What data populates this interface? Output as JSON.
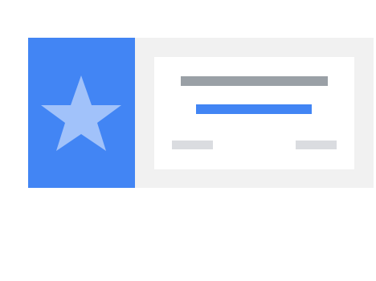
{
  "colors": {
    "accent": "#4285f4",
    "star": "#a1c2fa",
    "backdrop": "#f1f1f1",
    "card": "#ffffff",
    "title_bar": "#9aa0a6",
    "placeholder_bar": "#dadce0"
  },
  "icons": {
    "side_icon": "star-icon"
  }
}
